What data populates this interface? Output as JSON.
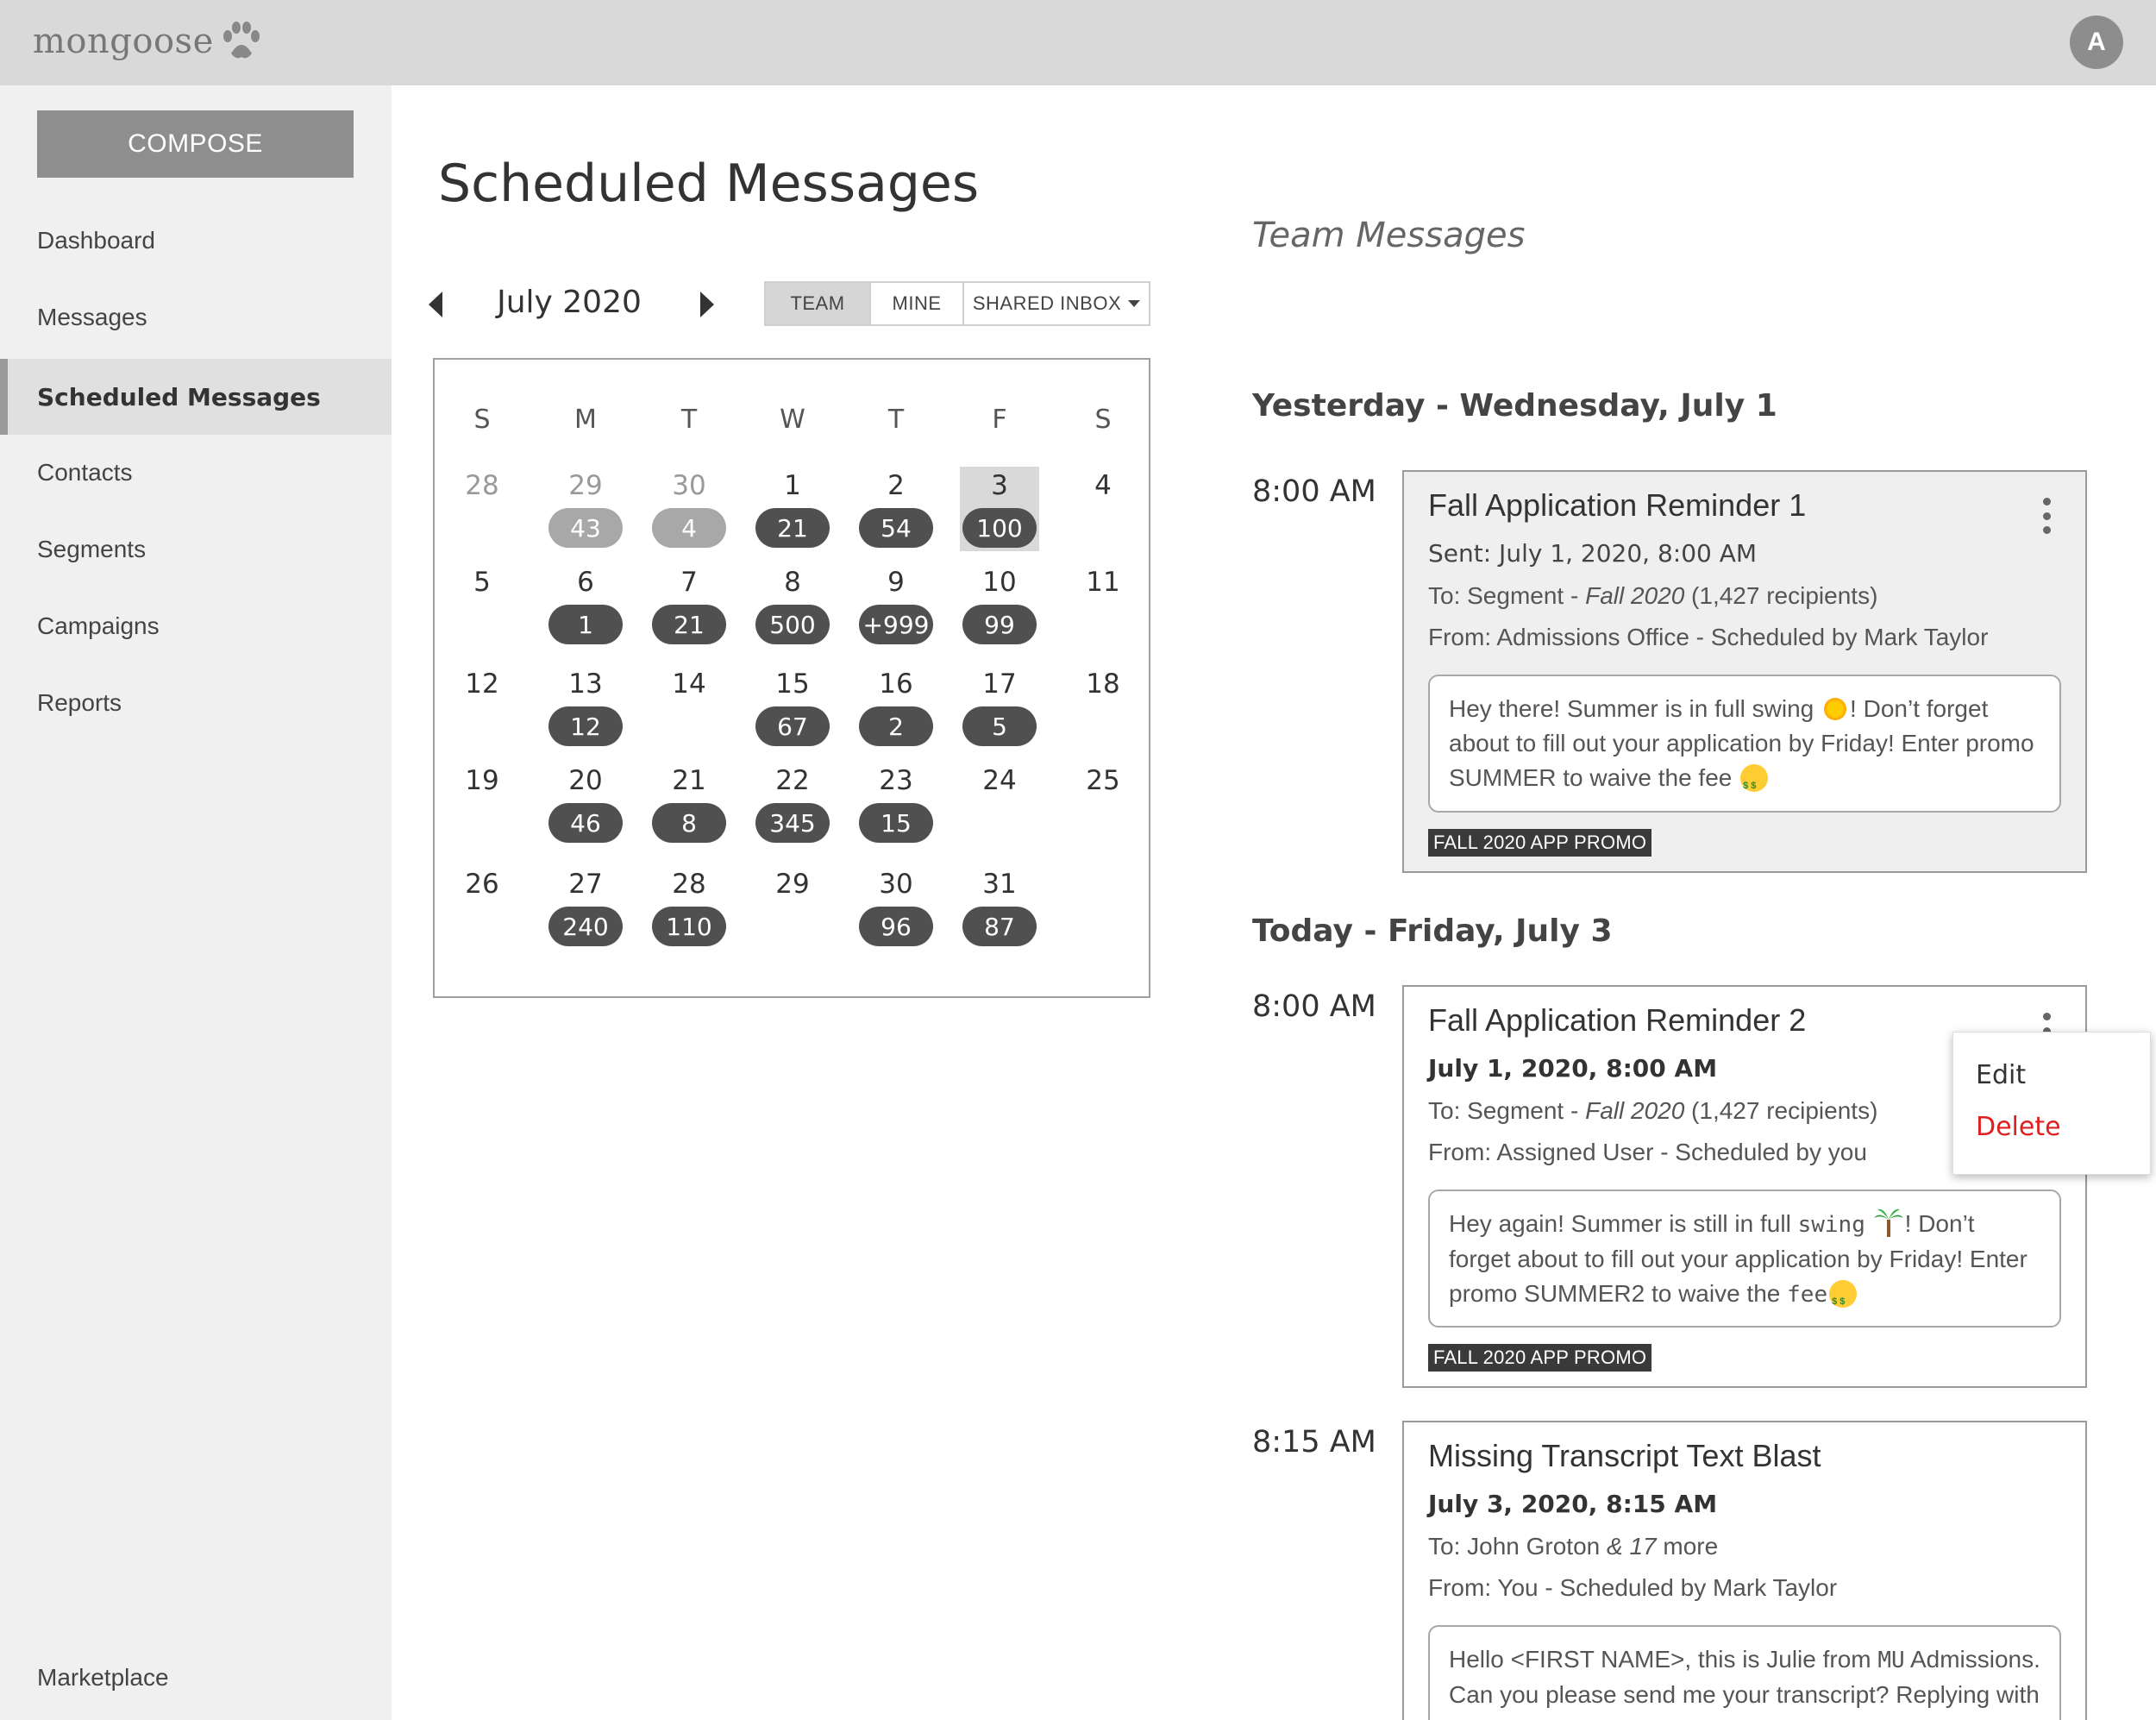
{
  "app": {
    "logo_text": "mongoose",
    "avatar_initial": "A"
  },
  "sidebar": {
    "compose_label": "COMPOSE",
    "items": [
      {
        "label": "Dashboard"
      },
      {
        "label": "Messages"
      },
      {
        "label": "Scheduled Messages",
        "active": true
      },
      {
        "label": "Contacts"
      },
      {
        "label": "Segments"
      },
      {
        "label": "Campaigns"
      },
      {
        "label": "Reports"
      }
    ],
    "bottom_item": "Marketplace"
  },
  "main": {
    "title": "Scheduled Messages",
    "month": "July 2020",
    "filters": [
      "TEAM",
      "MINE",
      "SHARED INBOX"
    ],
    "active_filter": "TEAM",
    "weekdays": [
      "S",
      "M",
      "T",
      "W",
      "T",
      "F",
      "S"
    ],
    "weeks": [
      [
        {
          "d": "28",
          "muted": true
        },
        {
          "d": "29",
          "c": "43",
          "muted": true
        },
        {
          "d": "30",
          "c": "4",
          "muted": true
        },
        {
          "d": "1",
          "c": "21"
        },
        {
          "d": "2",
          "c": "54"
        },
        {
          "d": "3",
          "c": "100",
          "today": true
        },
        {
          "d": "4"
        }
      ],
      [
        {
          "d": "5"
        },
        {
          "d": "6",
          "c": "1"
        },
        {
          "d": "7",
          "c": "21"
        },
        {
          "d": "8",
          "c": "500"
        },
        {
          "d": "9",
          "c": "+999"
        },
        {
          "d": "10",
          "c": "99"
        },
        {
          "d": "11"
        }
      ],
      [
        {
          "d": "12"
        },
        {
          "d": "13",
          "c": "12"
        },
        {
          "d": "14"
        },
        {
          "d": "15",
          "c": "67"
        },
        {
          "d": "16",
          "c": "2"
        },
        {
          "d": "17",
          "c": "5"
        },
        {
          "d": "18"
        }
      ],
      [
        {
          "d": "19"
        },
        {
          "d": "20",
          "c": "46"
        },
        {
          "d": "21",
          "c": "8"
        },
        {
          "d": "22",
          "c": "345"
        },
        {
          "d": "23",
          "c": "15"
        },
        {
          "d": "24"
        },
        {
          "d": "25"
        }
      ],
      [
        {
          "d": "26"
        },
        {
          "d": "27",
          "c": "240"
        },
        {
          "d": "28",
          "c": "110"
        },
        {
          "d": "29"
        },
        {
          "d": "30",
          "c": "96"
        },
        {
          "d": "31",
          "c": "87"
        }
      ]
    ]
  },
  "team": {
    "heading": "Team Messages",
    "yesterday_heading": "Yesterday - Wednesday, July 1",
    "today_heading": "Today - Friday, July 3",
    "messages": [
      {
        "time": "8:00 AM",
        "title": "Fall Application Reminder 1",
        "date_line": "Sent: July 1, 2020, 8:00 AM",
        "to_prefix": "To: Segment - ",
        "to_em": "Fall 2020",
        "to_suffix": " (1,427 recipients)",
        "from": "From: Admissions Office - Scheduled by Mark Taylor",
        "body_1": "Hey there! Summer is in full swing ",
        "body_2": "! Don’t forget about to fill out your application by Friday! Enter promo SUMMER to waive the fee ",
        "tag": "FALL 2020 APP PROMO"
      },
      {
        "time": "8:00 AM",
        "title": "Fall Application Reminder 2",
        "date_line": "July 1, 2020, 8:00 AM",
        "to_prefix": "To: Segment - ",
        "to_em": "Fall 2020",
        "to_suffix": " (1,427 recipients)",
        "from": "From: Assigned User - Scheduled by you",
        "body_1": "Hey again! Summer is still in full ",
        "body_mono_1": "swing",
        "body_2": "! Don’t forget about to fill out your application by Friday! Enter promo SUMMER2 to waive the ",
        "body_mono_2": "fee",
        "tag": "FALL 2020 APP PROMO"
      },
      {
        "time": "8:15 AM",
        "title": "Missing Transcript Text Blast",
        "date_line": "July 3, 2020, 8:15 AM",
        "to_prefix": "To: John Groton ",
        "to_em": "& 17",
        "to_suffix": " more",
        "from": "From: You - Scheduled by Mark Taylor",
        "body_1": "Hello <FIRST NAME>, this is Julie from ",
        "body_mono_1": "MU",
        "body_2": " Admissions. Can you please send me your transcript? Replying with a photo will keep the process going"
      }
    ]
  },
  "menu": {
    "edit": "Edit",
    "delete": "Delete",
    "delete_color": "#e02020"
  },
  "colors": {
    "topbar": "#d9d9d9",
    "sidebar": "#f0f0f1",
    "count_pill": "#505050",
    "compose": "#8e8e8e"
  }
}
